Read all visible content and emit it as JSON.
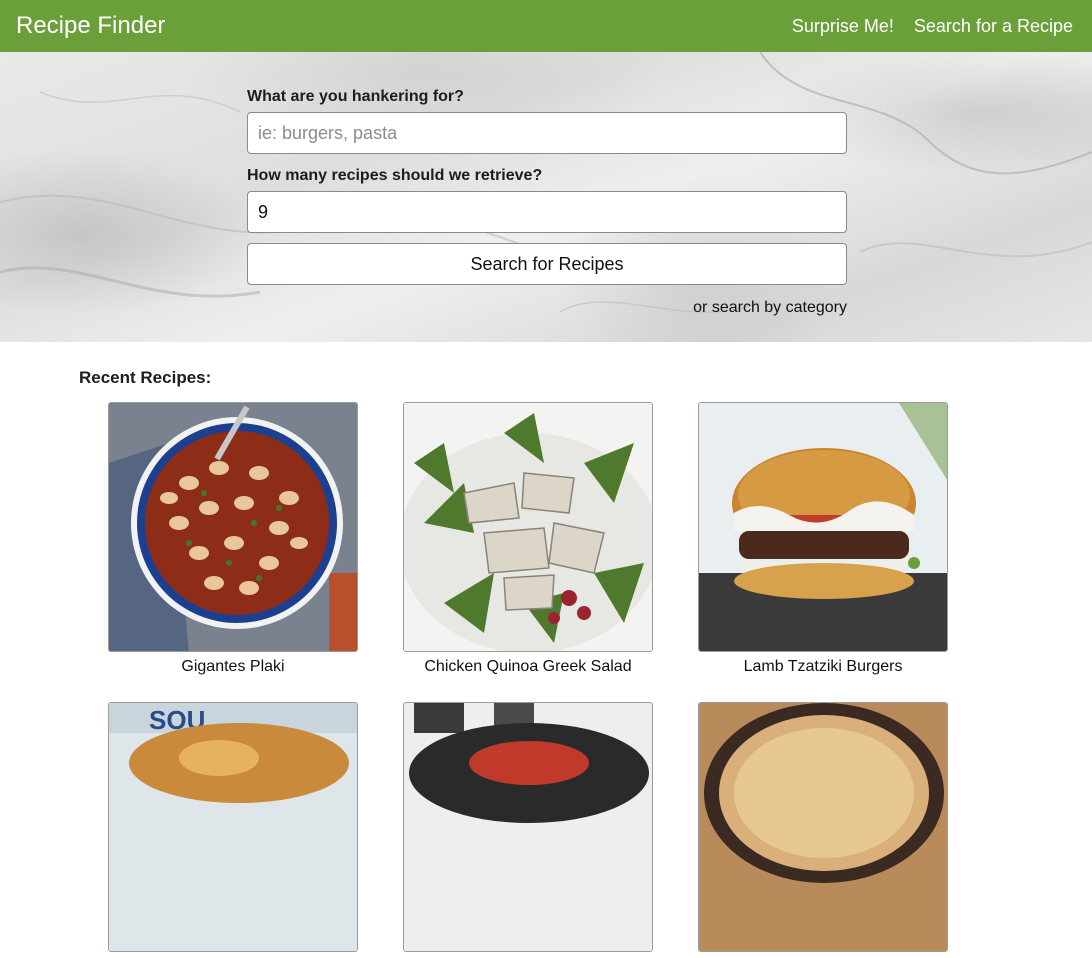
{
  "navbar": {
    "brand": "Recipe Finder",
    "links": [
      "Surprise Me!",
      "Search for a Recipe"
    ],
    "color": "#6a9f3a"
  },
  "search": {
    "query_label": "What are you hankering for?",
    "query_placeholder": "ie: burgers, pasta",
    "query_value": "",
    "count_label": "How many recipes should we retrieve?",
    "count_value": "9",
    "submit_label": "Search for Recipes",
    "category_link": "or search by category"
  },
  "recent": {
    "heading": "Recent Recipes:",
    "recipes": [
      {
        "title": "Gigantes Plaki"
      },
      {
        "title": "Chicken Quinoa Greek Salad"
      },
      {
        "title": "Lamb Tzatziki Burgers"
      },
      {
        "title": ""
      },
      {
        "title": ""
      },
      {
        "title": ""
      }
    ]
  }
}
